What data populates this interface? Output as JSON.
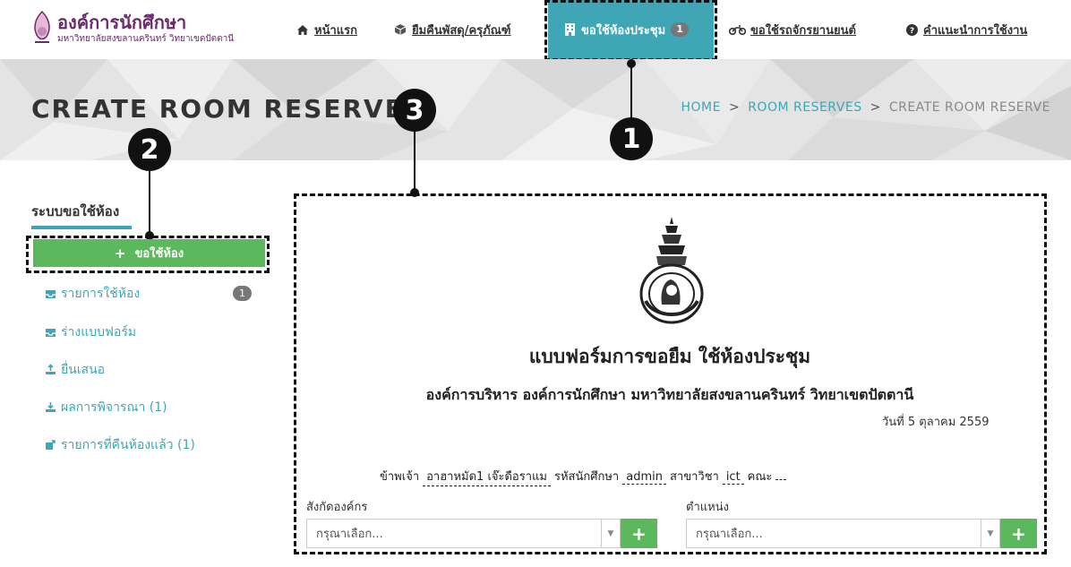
{
  "brand": {
    "title": "องค์การนักศึกษา",
    "subtitle": "มหาวิทยาลัยสงขลานครินทร์ วิทยาเขตปัตตานี"
  },
  "nav": {
    "home": "หน้าแรก",
    "borrow": "ยืมคืนพัสดุ/ครุภัณฑ์",
    "room": "ขอใช้ห้องประชุม",
    "room_badge": "1",
    "vehicle": "ขอใช้รถจักรยานยนต์",
    "help": "คำแนะนำการใช้งาน"
  },
  "page_title": "CREATE ROOM RESERVE",
  "breadcrumb": {
    "home": "HOME",
    "reserves": "ROOM RESERVES",
    "current": "CREATE ROOM RESERVE",
    "sep": ">"
  },
  "callouts": {
    "one": "1",
    "two": "2",
    "three": "3"
  },
  "sidebar": {
    "heading": "ระบบขอใช้ห้อง",
    "add_button": "ขอใช้ห้อง",
    "items": [
      {
        "label": "รายการใช้ห้อง",
        "badge": "1"
      },
      {
        "label": "ร่างแบบฟอร์ม"
      },
      {
        "label": "ยื่นเสนอ"
      },
      {
        "label": "ผลการพิจารณา (1)"
      },
      {
        "label": "รายการที่คืนห้องแล้ว (1)"
      }
    ]
  },
  "form": {
    "title": "แบบฟอร์มการขอยืม ใช้ห้องประชุม",
    "subtitle": "องค์การบริหาร องค์การนักศึกษา มหาวิทยาลัยสงขลานครินทร์ วิทยาเขตปัตตานี",
    "date": "วันที่ 5 ตุลาคม 2559",
    "declaration": {
      "l1": "ข้าพเจ้า",
      "name": "อาฮาหมัด1 เจ๊ะดือราแม",
      "l2": "รหัสนักศึกษา",
      "student_id": "admin",
      "l3": "สาขาวิชา",
      "major": "ict",
      "l4": "คณะ",
      "faculty": ""
    },
    "org_label": "สังกัดองค์กร",
    "org_placeholder": "กรุณาเลือก...",
    "position_label": "ตำแหน่ง",
    "position_placeholder": "กรุณาเลือก..."
  }
}
